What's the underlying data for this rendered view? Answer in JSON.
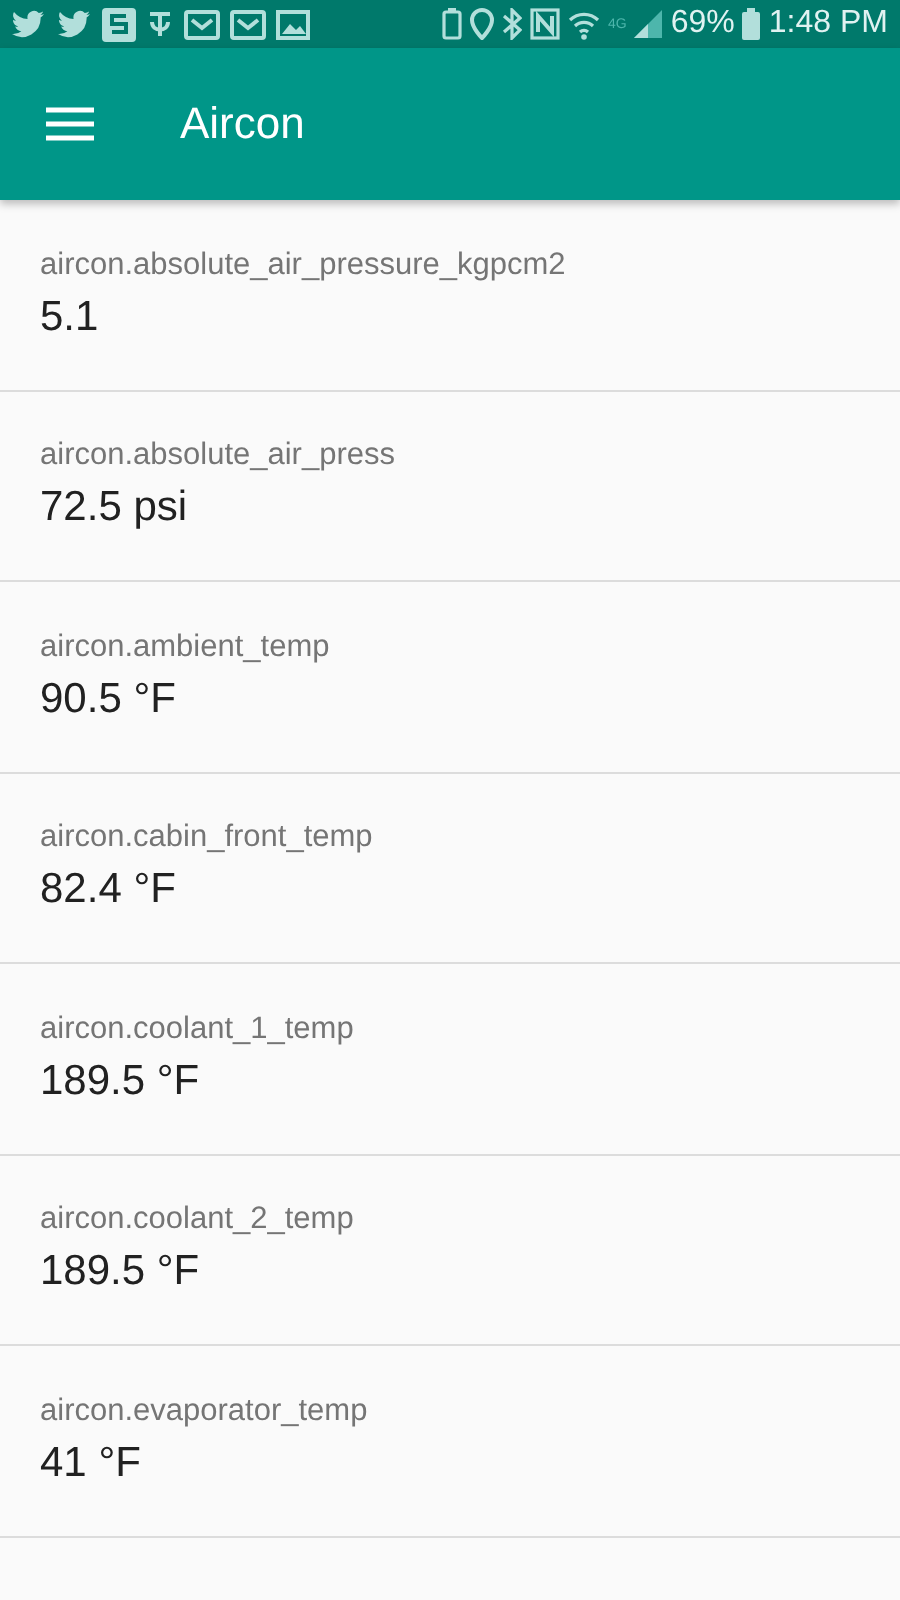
{
  "status_bar": {
    "network": "4G",
    "battery": "69%",
    "time": "1:48 PM"
  },
  "app_bar": {
    "title": "Aircon"
  },
  "items": [
    {
      "label": "aircon.absolute_air_pressure_kgpcm2",
      "value": "5.1"
    },
    {
      "label": "aircon.absolute_air_press",
      "value": "72.5 psi"
    },
    {
      "label": "aircon.ambient_temp",
      "value": "90.5 °F"
    },
    {
      "label": "aircon.cabin_front_temp",
      "value": "82.4 °F"
    },
    {
      "label": "aircon.coolant_1_temp",
      "value": "189.5 °F"
    },
    {
      "label": "aircon.coolant_2_temp",
      "value": "189.5 °F"
    },
    {
      "label": "aircon.evaporator_temp",
      "value": "41 °F"
    }
  ]
}
